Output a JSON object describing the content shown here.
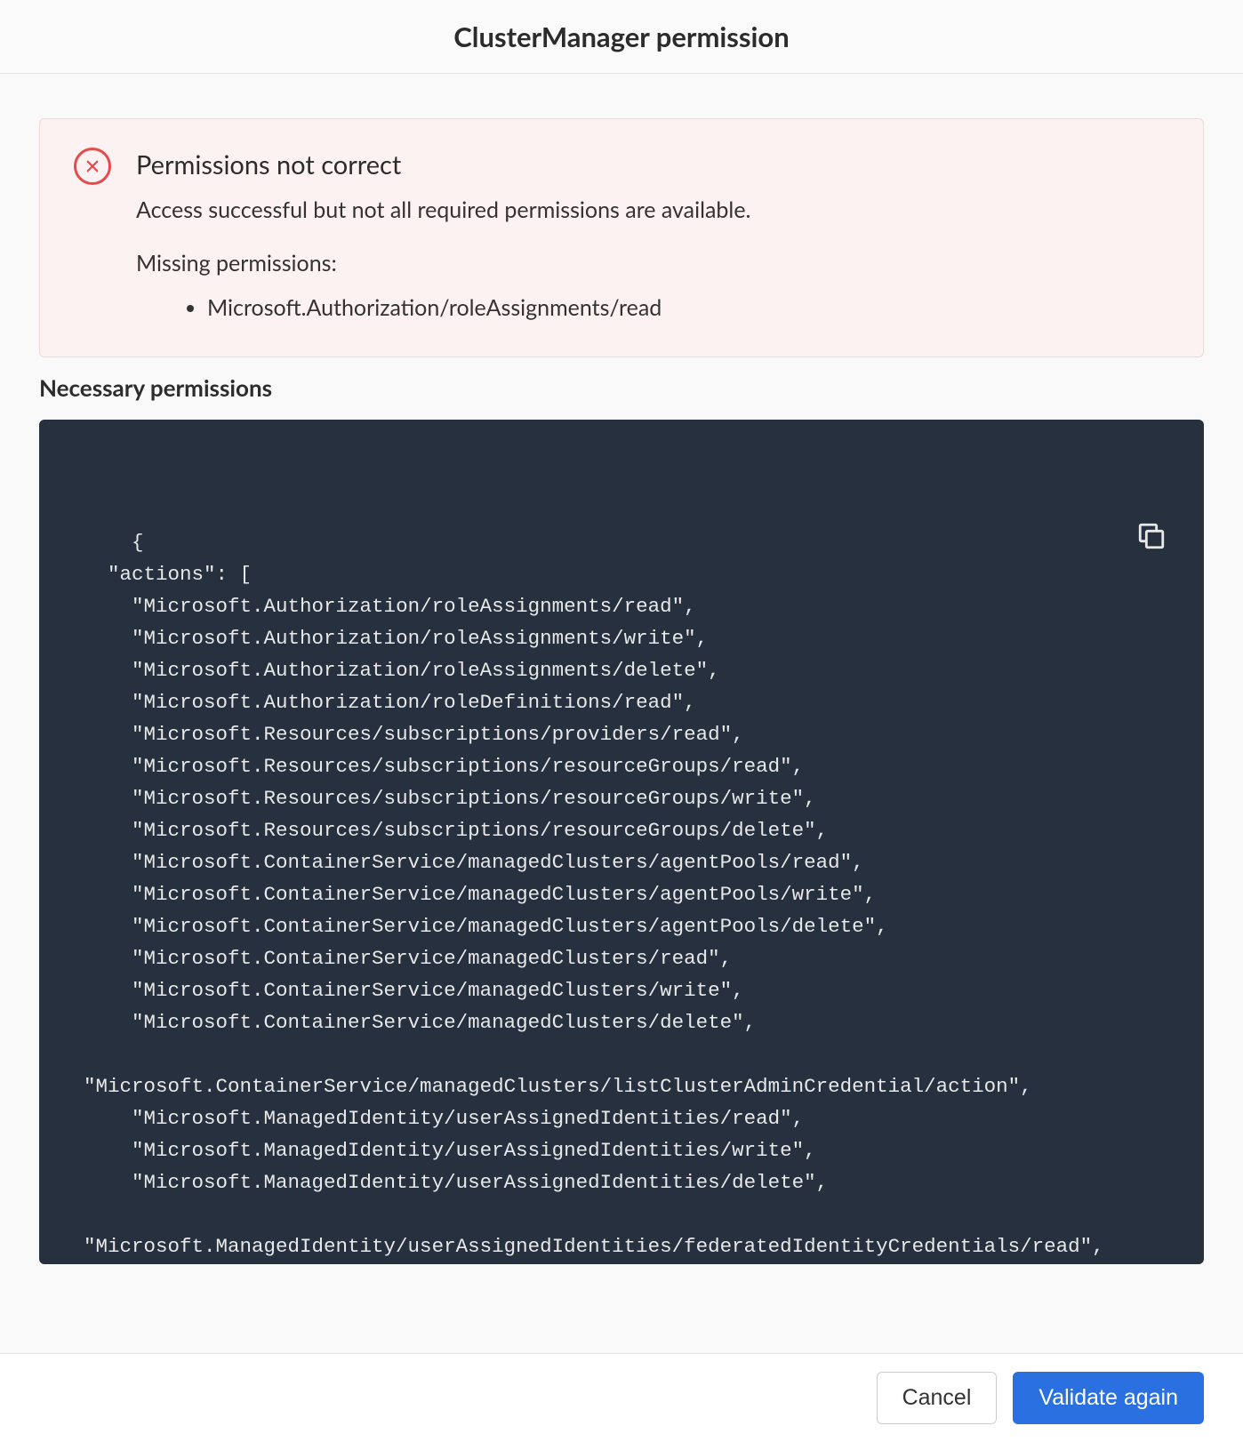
{
  "header": {
    "title": "ClusterManager permission"
  },
  "alert": {
    "title": "Permissions not correct",
    "message": "Access successful but not all required permissions are available.",
    "missing_label": "Missing permissions:",
    "missing_items": [
      "Microsoft.Authorization/roleAssignments/read"
    ]
  },
  "section_title": "Necessary permissions",
  "permissions_json": {
    "actions": [
      "Microsoft.Authorization/roleAssignments/read",
      "Microsoft.Authorization/roleAssignments/write",
      "Microsoft.Authorization/roleAssignments/delete",
      "Microsoft.Authorization/roleDefinitions/read",
      "Microsoft.Resources/subscriptions/providers/read",
      "Microsoft.Resources/subscriptions/resourceGroups/read",
      "Microsoft.Resources/subscriptions/resourceGroups/write",
      "Microsoft.Resources/subscriptions/resourceGroups/delete",
      "Microsoft.ContainerService/managedClusters/agentPools/read",
      "Microsoft.ContainerService/managedClusters/agentPools/write",
      "Microsoft.ContainerService/managedClusters/agentPools/delete",
      "Microsoft.ContainerService/managedClusters/read",
      "Microsoft.ContainerService/managedClusters/write",
      "Microsoft.ContainerService/managedClusters/delete",
      "Microsoft.ContainerService/managedClusters/listClusterAdminCredential/action",
      "Microsoft.ManagedIdentity/userAssignedIdentities/read",
      "Microsoft.ManagedIdentity/userAssignedIdentities/write",
      "Microsoft.ManagedIdentity/userAssignedIdentities/delete",
      "Microsoft.ManagedIdentity/userAssignedIdentities/federatedIdentityCredentials/read"
    ]
  },
  "footer": {
    "cancel": "Cancel",
    "validate": "Validate again"
  }
}
